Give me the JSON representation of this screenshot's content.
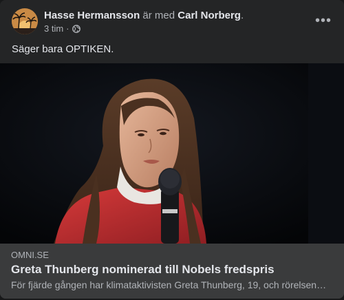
{
  "post": {
    "author": "Hasse Hermansson",
    "with_text": "är med",
    "tagged": "Carl Norberg",
    "period": ".",
    "time": "3 tim",
    "separator": "·",
    "privacy_icon": "globe-icon",
    "more_icon": "more-options-icon",
    "more_label": "•••",
    "text": "Säger bara OPTIKEN."
  },
  "link_preview": {
    "domain": "OMNI.SE",
    "title": "Greta Thunberg nominerad till Nobels fredspris",
    "description": "För fjärde gången har klimataktivisten Greta Thunberg, 19, och rörelsen Fridays for Future nominerats"
  },
  "colors": {
    "card_bg": "#242526",
    "link_card_bg": "#3a3b3c",
    "text_primary": "#e4e6eb",
    "text_secondary": "#b0b3b8"
  }
}
